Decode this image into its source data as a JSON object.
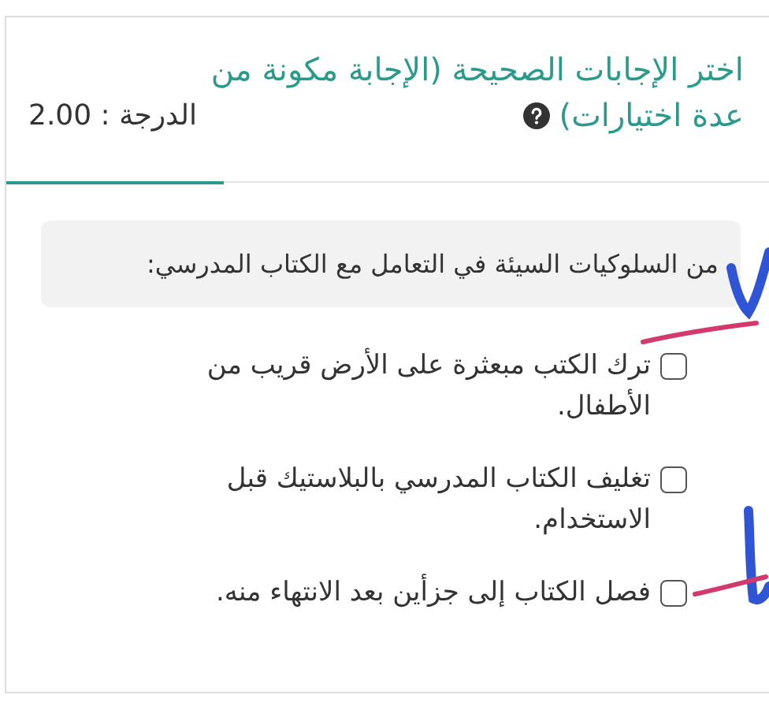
{
  "question": {
    "title_lines": [
      "اختر الإجابات الصحيحة (الإجابة مكونة من",
      "عدة اختيارات)"
    ],
    "grade": "الدرجة : 2.00",
    "prompt": "من السلوكيات السيئة في التعامل مع الكتاب المدرسي:",
    "options": [
      {
        "text": "ترك الكتب مبعثرة على الأرض قريب من الأطفال.",
        "checked": false
      },
      {
        "text": "تغليف الكتاب المدرسي بالبلاستيك قبل الاستخدام.",
        "checked": false
      },
      {
        "text": "فصل الكتاب إلى جزأين بعد الانتهاء منه.",
        "checked": false
      }
    ]
  }
}
